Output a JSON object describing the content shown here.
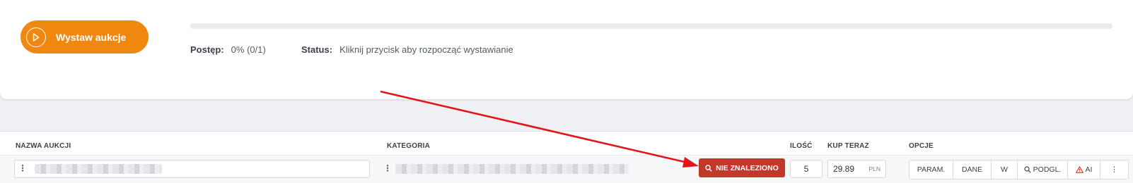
{
  "publish": {
    "label": "Wystaw aukcje",
    "accent": "#f0880f"
  },
  "progress": {
    "fraction": 0,
    "label": "Postęp:",
    "value": "0% (0/1)"
  },
  "status": {
    "label": "Status:",
    "value": "Kliknij przycisk aby rozpocząć wystawianie"
  },
  "table": {
    "headers": {
      "name": "NAZWA AUKCJI",
      "category": "KATEGORIA",
      "qty": "ILOŚĆ",
      "buy_now": "KUP TERAZ",
      "options": "OPCJE"
    },
    "row": {
      "not_found_label": "NIE ZNALEZIONO",
      "not_found_color": "#c0392b",
      "qty": "5",
      "price": "29.89",
      "currency": "PLN",
      "options": [
        "PARAM.",
        "DANE",
        "W",
        "PODGL.",
        "AI",
        "⋮"
      ]
    }
  },
  "annotation": {
    "arrow_color": "#e0161b"
  }
}
